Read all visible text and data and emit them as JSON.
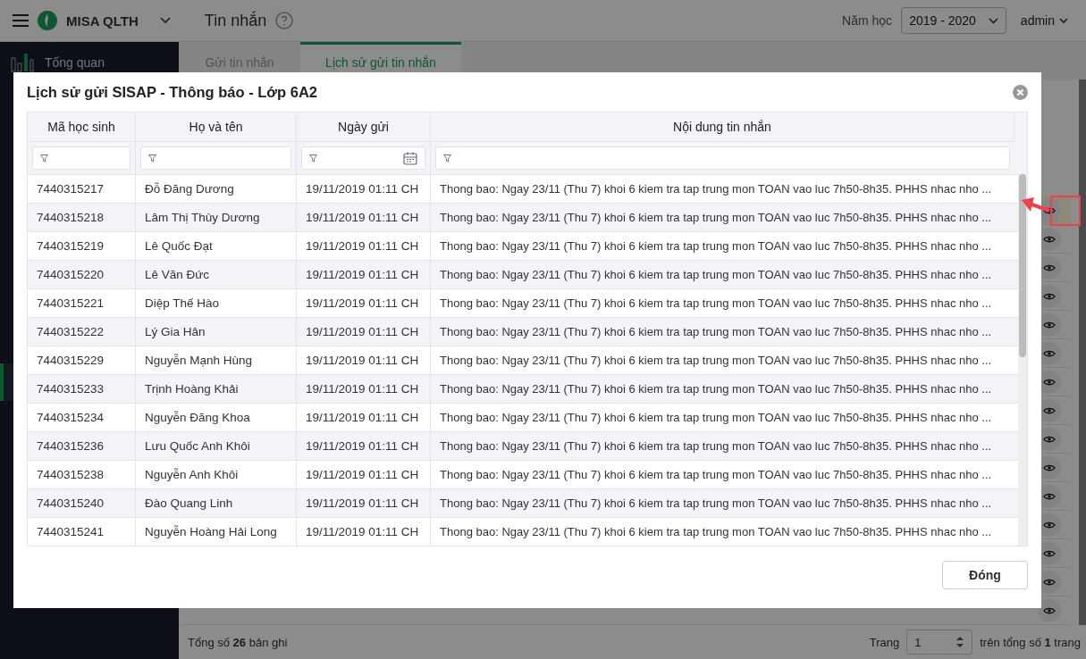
{
  "app": {
    "brand": "MISA QLTH",
    "page_title": "Tin nhắn",
    "school_year_label": "Năm học",
    "school_year": "2019 - 2020",
    "user": "admin"
  },
  "sidebar": {
    "items": [
      {
        "label": "Tổng quan"
      }
    ]
  },
  "tabs": [
    {
      "label": "Gửi tin nhắn",
      "selected": false
    },
    {
      "label": "Lịch sử gửi tin nhắn",
      "selected": true
    }
  ],
  "background_table": {
    "rows": [
      {
        "highlighted": true
      },
      {
        "highlighted": false
      },
      {
        "highlighted": false
      },
      {
        "highlighted": false
      },
      {
        "highlighted": false
      },
      {
        "highlighted": false
      },
      {
        "highlighted": false
      },
      {
        "highlighted": false
      },
      {
        "highlighted": false
      },
      {
        "highlighted": false
      },
      {
        "highlighted": false
      },
      {
        "highlighted": false
      },
      {
        "highlighted": false
      },
      {
        "highlighted": false
      },
      {
        "highlighted": false
      }
    ]
  },
  "footer": {
    "total": "Tổng số **26** bản ghi",
    "page_label": "Trang",
    "page": "1",
    "page_total": "trên tổng số **1** trang"
  },
  "dialog": {
    "title": "Lịch sử gửi SISAP - Thông báo - Lớp 6A2",
    "columns": [
      {
        "label": "Mã học sinh",
        "kind": "text"
      },
      {
        "label": "Họ và tên",
        "kind": "text"
      },
      {
        "label": "Ngày gửi",
        "kind": "date"
      },
      {
        "label": "Nội dung tin nhắn",
        "kind": "text"
      }
    ],
    "rows": [
      {
        "student_id": "7440315217",
        "name": "Đỗ Đăng Dương",
        "sent": "19/11/2019 01:11 CH",
        "message": "Thong bao: Ngay 23/11 (Thu 7) khoi 6 kiem tra tap trung mon TOAN vao luc 7h50-8h35. PHHS nhac nho ..."
      },
      {
        "student_id": "7440315218",
        "name": "Lâm Thị Thùy Dương",
        "sent": "19/11/2019 01:11 CH",
        "message": "Thong bao: Ngay 23/11 (Thu 7) khoi 6 kiem tra tap trung mon TOAN vao luc 7h50-8h35. PHHS nhac nho ..."
      },
      {
        "student_id": "7440315219",
        "name": "Lê Quốc Đạt",
        "sent": "19/11/2019 01:11 CH",
        "message": "Thong bao: Ngay 23/11 (Thu 7) khoi 6 kiem tra tap trung mon TOAN vao luc 7h50-8h35. PHHS nhac nho ..."
      },
      {
        "student_id": "7440315220",
        "name": "Lê Văn Đức",
        "sent": "19/11/2019 01:11 CH",
        "message": "Thong bao: Ngay 23/11 (Thu 7) khoi 6 kiem tra tap trung mon TOAN vao luc 7h50-8h35. PHHS nhac nho ..."
      },
      {
        "student_id": "7440315221",
        "name": "Diệp Thế Hào",
        "sent": "19/11/2019 01:11 CH",
        "message": "Thong bao: Ngay 23/11 (Thu 7) khoi 6 kiem tra tap trung mon TOAN vao luc 7h50-8h35. PHHS nhac nho ..."
      },
      {
        "student_id": "7440315222",
        "name": "Lý Gia Hân",
        "sent": "19/11/2019 01:11 CH",
        "message": "Thong bao: Ngay 23/11 (Thu 7) khoi 6 kiem tra tap trung mon TOAN vao luc 7h50-8h35. PHHS nhac nho ..."
      },
      {
        "student_id": "7440315229",
        "name": "Nguyễn Mạnh Hùng",
        "sent": "19/11/2019 01:11 CH",
        "message": "Thong bao: Ngay 23/11 (Thu 7) khoi 6 kiem tra tap trung mon TOAN vao luc 7h50-8h35. PHHS nhac nho ..."
      },
      {
        "student_id": "7440315233",
        "name": "Trịnh Hoàng Khải",
        "sent": "19/11/2019 01:11 CH",
        "message": "Thong bao: Ngay 23/11 (Thu 7) khoi 6 kiem tra tap trung mon TOAN vao luc 7h50-8h35. PHHS nhac nho ..."
      },
      {
        "student_id": "7440315234",
        "name": "Nguyễn Đăng Khoa",
        "sent": "19/11/2019 01:11 CH",
        "message": "Thong bao: Ngay 23/11 (Thu 7) khoi 6 kiem tra tap trung mon TOAN vao luc 7h50-8h35. PHHS nhac nho ..."
      },
      {
        "student_id": "7440315236",
        "name": "Lưu Quốc Anh Khôi",
        "sent": "19/11/2019 01:11 CH",
        "message": "Thong bao: Ngay 23/11 (Thu 7) khoi 6 kiem tra tap trung mon TOAN vao luc 7h50-8h35. PHHS nhac nho ..."
      },
      {
        "student_id": "7440315238",
        "name": "Nguyễn Anh Khôi",
        "sent": "19/11/2019 01:11 CH",
        "message": "Thong bao: Ngay 23/11 (Thu 7) khoi 6 kiem tra tap trung mon TOAN vao luc 7h50-8h35. PHHS nhac nho ..."
      },
      {
        "student_id": "7440315240",
        "name": "Đào Quang Linh",
        "sent": "19/11/2019 01:11 CH",
        "message": "Thong bao: Ngay 23/11 (Thu 7) khoi 6 kiem tra tap trung mon TOAN vao luc 7h50-8h35. PHHS nhac nho ..."
      },
      {
        "student_id": "7440315241",
        "name": "Nguyễn Hoàng Hải Long",
        "sent": "19/11/2019 01:11 CH",
        "message": "Thong bao: Ngay 23/11 (Thu 7) khoi 6 kiem tra tap trung mon TOAN vao luc 7h50-8h35. PHHS nhac nho ..."
      }
    ],
    "close_button": "Đóng"
  }
}
